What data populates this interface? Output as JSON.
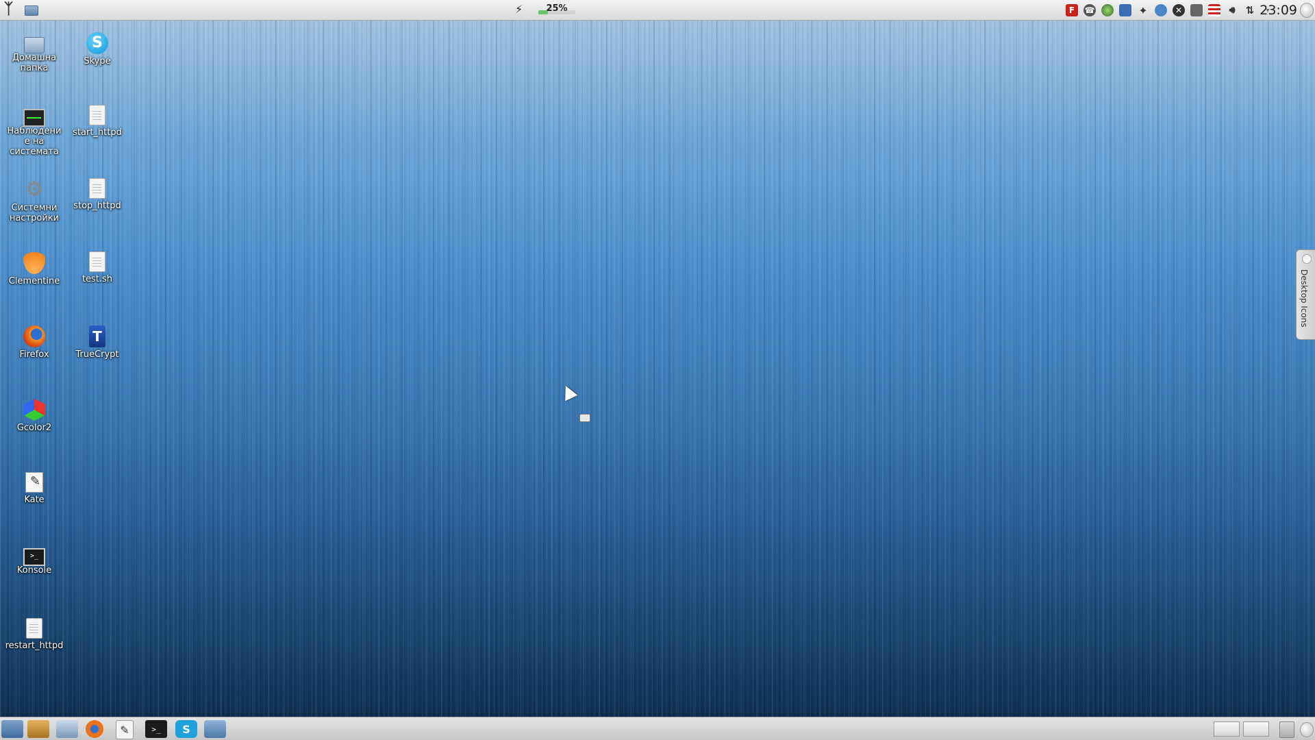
{
  "top_panel": {
    "battery_percent_text": "25%",
    "battery_level": 0.25,
    "clock": "23:09",
    "tray_icons": [
      "filezilla-icon",
      "phone-icon",
      "network-globe-icon",
      "clipboard-window-icon",
      "dropbox-icon",
      "network-manager-icon",
      "close-circle-icon",
      "klipper-icon",
      "us-flag-icon",
      "volume-icon",
      "updown-arrows-icon"
    ]
  },
  "desktop": {
    "icons": [
      {
        "name": "home-folder",
        "label": "Домашна папка"
      },
      {
        "name": "skype",
        "label": "Skype"
      },
      {
        "name": "system-monitor",
        "label": "Наблюдение на системата"
      },
      {
        "name": "start-httpd",
        "label": "start_httpd"
      },
      {
        "name": "system-settings",
        "label": "Системни настройки"
      },
      {
        "name": "stop-httpd",
        "label": "stop_httpd"
      },
      {
        "name": "clementine",
        "label": "Clementine"
      },
      {
        "name": "test-sh",
        "label": "test.sh"
      },
      {
        "name": "firefox",
        "label": "Firefox"
      },
      {
        "name": "truecrypt",
        "label": "TrueCrypt"
      },
      {
        "name": "gcolor2",
        "label": "Gcolor2"
      },
      {
        "name": "kate",
        "label": "Kate"
      },
      {
        "name": "konsole",
        "label": "Konsole"
      },
      {
        "name": "restart-httpd",
        "label": "restart_httpd"
      }
    ]
  },
  "side_tab": {
    "label": "Desktop Icons"
  },
  "taskbar": {
    "buttons": [
      "show-desktop-icon",
      "package-icon",
      "file-manager-icon",
      "firefox-icon",
      "kate-icon",
      "konsole-icon",
      "skype-icon",
      "app-launcher-icon"
    ]
  },
  "colors": {
    "wallpaper_top": "#aac6e0",
    "wallpaper_mid": "#3b78b4",
    "wallpaper_bottom": "#0c2845",
    "panel": "#dcdcdc"
  }
}
